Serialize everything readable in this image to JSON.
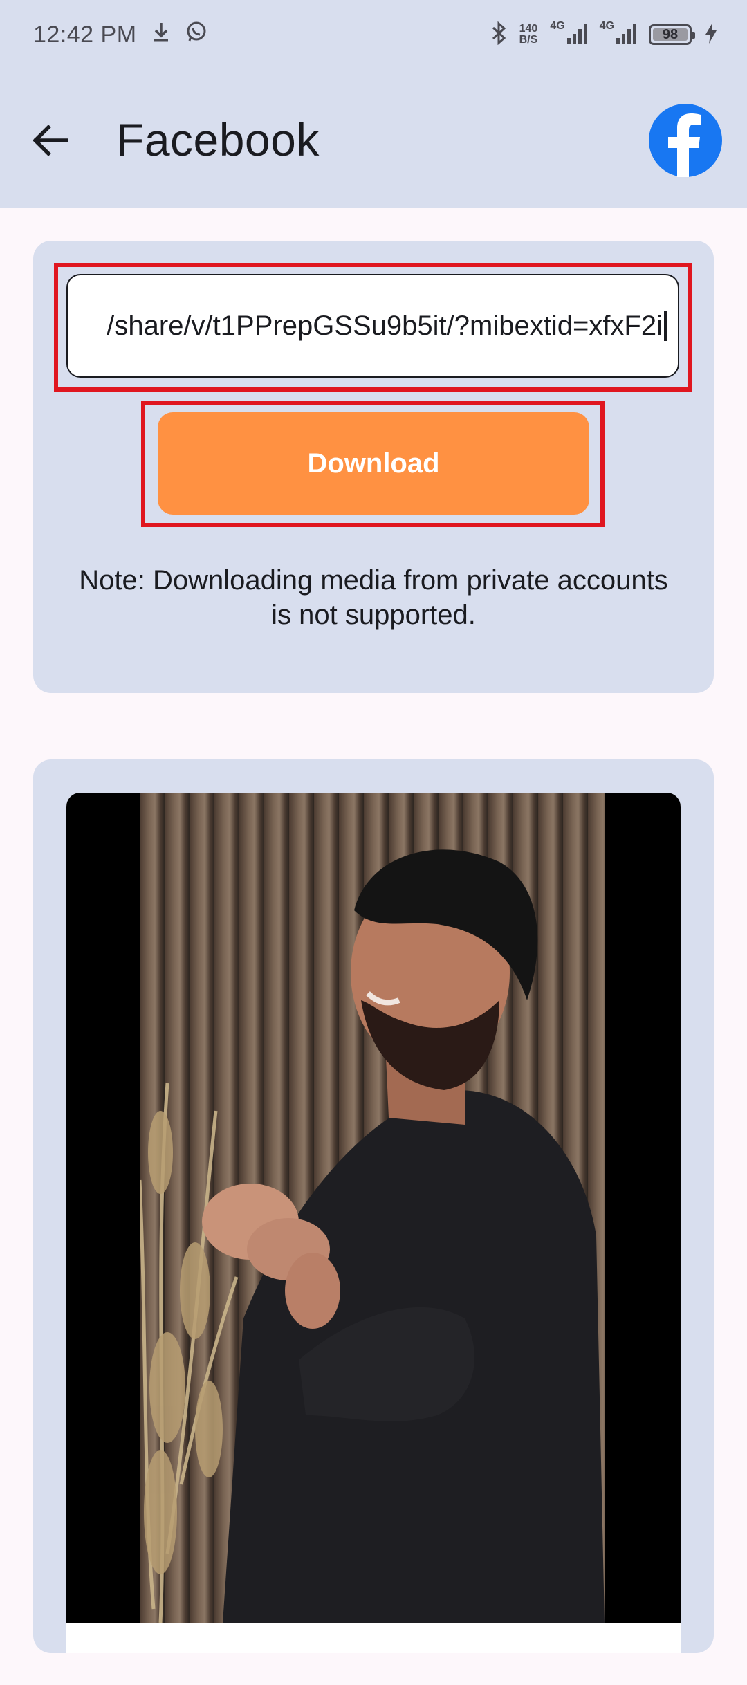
{
  "status_bar": {
    "time": "12:42 PM",
    "net_speed_value": "140",
    "net_speed_unit": "B/S",
    "network_1": "4G",
    "network_2": "4G",
    "battery": "98",
    "icons": [
      "download-icon",
      "whatsapp-icon",
      "bluetooth-icon",
      "signal-icon",
      "signal-icon",
      "battery-icon",
      "charging-icon"
    ]
  },
  "app_bar": {
    "title": "Facebook",
    "back_icon": "arrow-left-icon",
    "logo_icon": "facebook-icon"
  },
  "form": {
    "url_value": "/share/v/t1PPrepGSSu9b5it/?mibextid=xfxF2i",
    "download_label": "Download",
    "note": "Note: Downloading media from private accounts is not supported."
  },
  "colors": {
    "app_bar": "#d8deee",
    "accent_button": "#ff9142",
    "highlight_outline": "#e0161f",
    "facebook_blue": "#1877f2"
  }
}
